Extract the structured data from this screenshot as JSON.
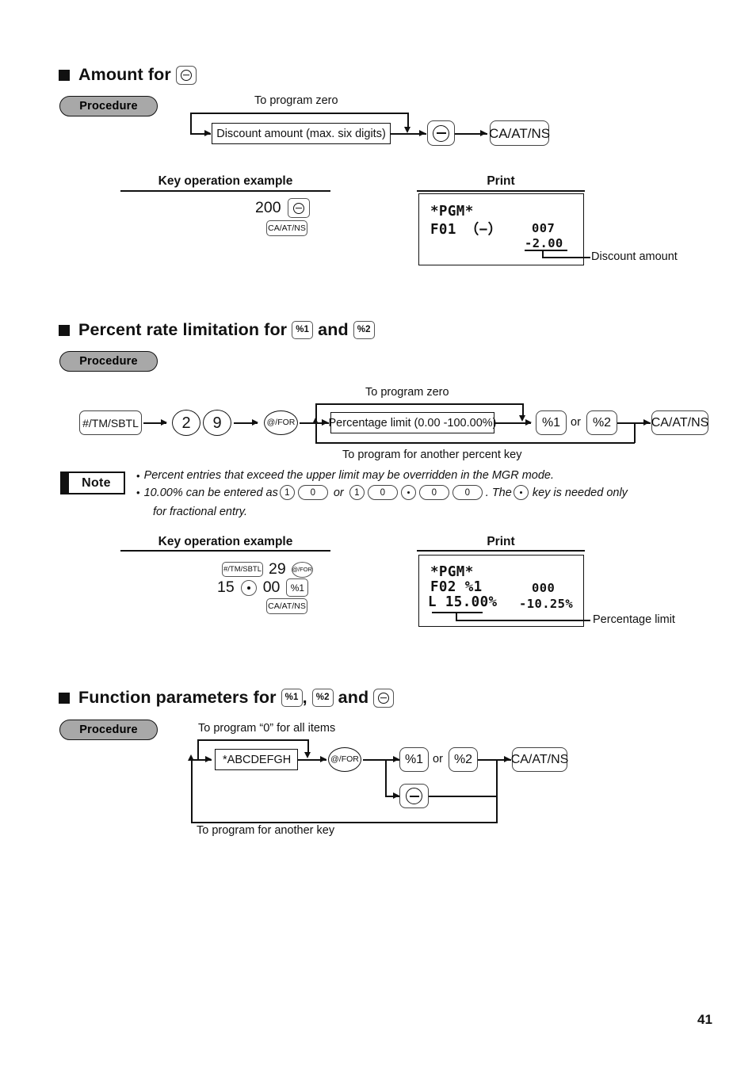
{
  "page": {
    "number": "41"
  },
  "sections": [
    {
      "id": "amount-for-minus",
      "title_prefix": "Amount for",
      "procedure_label": "Procedure",
      "flow": {
        "bypass_label": "To program zero",
        "entry_box": "Discount amount (max. six digits)",
        "key_minus": "⊖",
        "key_finalize": "CA/AT/NS"
      },
      "example_header": "Key operation example",
      "print_header": "Print",
      "example": {
        "row1_number": "200",
        "row1_key": "⊖",
        "row2_key": "CA/AT/NS"
      },
      "print": {
        "line1": "*PGM*",
        "line2_left": "F01 （−）",
        "line2_right": "007",
        "line3_right": "-2.00",
        "callout": "Discount amount"
      }
    },
    {
      "id": "percent-rate-limitation",
      "title_prefix": "Percent rate limitation for",
      "title_mid": "and",
      "key_pct1": "%1",
      "key_pct2": "%2",
      "procedure_label": "Procedure",
      "flow": {
        "start_key": "#/TM/SBTL",
        "digit_2": "2",
        "digit_9": "9",
        "at_for": "@/FOR",
        "bypass_top_label": "To program zero",
        "bypass_bottom_label": "To program for another percent key",
        "entry_box": "Percentage limit (0.00 -100.00%)",
        "key_pct1": "%1",
        "or_label": "or",
        "key_pct2": "%2",
        "key_finalize": "CA/AT/NS"
      },
      "note": {
        "badge": "Note",
        "bullet1": "Percent entries that exceed the upper limit may be overridden in the MGR mode.",
        "bullet2_a": "10.00% can be entered as",
        "bullet2_keys_1": [
          "1",
          "0"
        ],
        "bullet2_or": "or",
        "bullet2_keys_2": [
          "1",
          "0",
          "·",
          "0",
          "0"
        ],
        "bullet2_b": ".  The",
        "bullet2_c": "key is needed only",
        "bullet2_d": "for fractional entry."
      },
      "example_header": "Key operation example",
      "print_header": "Print",
      "example": {
        "row1_key": "#/TM/SBTL",
        "row1_number": "29",
        "row1_key2": "@/FOR",
        "row2_number_a": "15",
        "row2_dot": "·",
        "row2_number_b": "00",
        "row2_key": "%1",
        "row3_key": "CA/AT/NS"
      },
      "print": {
        "line1": "*PGM*",
        "line2_left": "F02 %1",
        "line2_right": "000",
        "line3_left": "L 15.00%",
        "line3_right": "-10.25%",
        "callout": "Percentage limit"
      }
    },
    {
      "id": "function-parameters",
      "title_prefix": "Function parameters for",
      "title_comma": ",",
      "title_mid": "and",
      "key_pct1": "%1",
      "key_pct2": "%2",
      "key_minus": "⊖",
      "procedure_label": "Procedure",
      "flow": {
        "bypass_top_label": "To program “0” for all items",
        "bypass_bottom_label": "To program for another key",
        "entry_box": "*ABCDEFGH",
        "at_for": "@/FOR",
        "key_pct1": "%1",
        "or_label": "or",
        "key_pct2": "%2",
        "key_minus": "⊖",
        "key_finalize": "CA/AT/NS"
      }
    }
  ]
}
